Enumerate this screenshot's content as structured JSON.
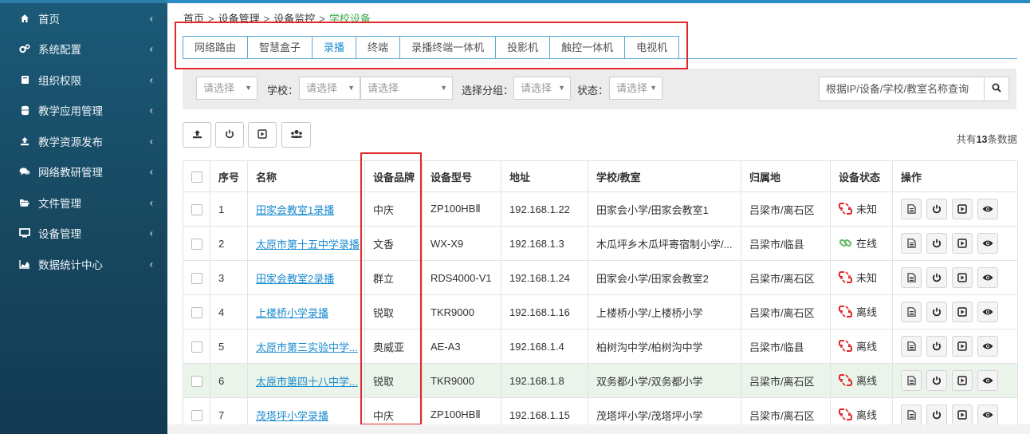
{
  "sidebar": {
    "items": [
      {
        "label": "首页",
        "icon": "home-icon"
      },
      {
        "label": "系统配置",
        "icon": "cogs-icon"
      },
      {
        "label": "组织权限",
        "icon": "book-icon"
      },
      {
        "label": "教学应用管理",
        "icon": "database-icon"
      },
      {
        "label": "教学资源发布",
        "icon": "upload-icon"
      },
      {
        "label": "网络教研管理",
        "icon": "comments-icon"
      },
      {
        "label": "文件管理",
        "icon": "folder-open-icon"
      },
      {
        "label": "设备管理",
        "icon": "monitor-icon"
      },
      {
        "label": "数据统计中心",
        "icon": "area-chart-icon"
      }
    ]
  },
  "breadcrumb": {
    "home": "首页",
    "level1": "设备管理",
    "level2": "设备监控",
    "current": "学校设备",
    "separator": ">"
  },
  "tabs": [
    "网络路由",
    "智慧盒子",
    "录播",
    "终端",
    "录播终端一体机",
    "投影机",
    "触控一体机",
    "电视机"
  ],
  "active_tab": "录播",
  "filters": {
    "select1_placeholder": "请选择",
    "school_label": "学校：",
    "school_placeholder": "请选择",
    "school_class_placeholder": "请选择",
    "group_label": "选择分组：",
    "group_placeholder": "请选择",
    "status_label": "状态：",
    "status_placeholder": "请选择",
    "search_placeholder": "根据IP/设备/学校/教室名称查询"
  },
  "toolbar": {
    "buttons": [
      "upload-icon",
      "power-icon",
      "play-icon",
      "users-icon"
    ],
    "total_prefix": "共有",
    "total_count": "13",
    "total_suffix": "条数据"
  },
  "table": {
    "headers": [
      "序号",
      "名称",
      "设备品牌",
      "设备型号",
      "地址",
      "学校/教室",
      "归属地",
      "设备状态",
      "操作"
    ],
    "rows": [
      {
        "no": "1",
        "name": "田家会教室1录播",
        "brand": "中庆",
        "model": "ZP100HBⅡ",
        "ip": "192.168.1.22",
        "school": "田家会小学/田家会教室1",
        "region": "吕梁市/离石区",
        "status": "未知",
        "status_icon": "unlink-icon"
      },
      {
        "no": "2",
        "name": "太原市第十五中学录播",
        "brand": "文香",
        "model": "WX-X9",
        "ip": "192.168.1.3",
        "school": "木瓜坪乡木瓜坪寄宿制小学/...",
        "region": "吕梁市/临县",
        "status": "在线",
        "status_icon": "link-icon"
      },
      {
        "no": "3",
        "name": "田家会教室2录播",
        "brand": "群立",
        "model": "RDS4000-V1",
        "ip": "192.168.1.24",
        "school": "田家会小学/田家会教室2",
        "region": "吕梁市/离石区",
        "status": "未知",
        "status_icon": "unlink-icon"
      },
      {
        "no": "4",
        "name": "上楼桥小学录播",
        "brand": "锐取",
        "model": "TKR9000",
        "ip": "192.168.1.16",
        "school": "上楼桥小学/上楼桥小学",
        "region": "吕梁市/离石区",
        "status": "离线",
        "status_icon": "unlink-icon"
      },
      {
        "no": "5",
        "name": "太原市第三实验中学...",
        "brand": "奥威亚",
        "model": "AE-A3",
        "ip": "192.168.1.4",
        "school": "柏树沟中学/柏树沟中学",
        "region": "吕梁市/临县",
        "status": "离线",
        "status_icon": "unlink-icon"
      },
      {
        "no": "6",
        "name": "太原市第四十八中学...",
        "brand": "锐取",
        "model": "TKR9000",
        "ip": "192.168.1.8",
        "school": "双务都小学/双务都小学",
        "region": "吕梁市/离石区",
        "status": "离线",
        "status_icon": "unlink-icon"
      },
      {
        "no": "7",
        "name": "茂塔坪小学录播",
        "brand": "中庆",
        "model": "ZP100HBⅡ",
        "ip": "192.168.1.15",
        "school": "茂塔坪小学/茂塔坪小学",
        "region": "吕梁市/离石区",
        "status": "离线",
        "status_icon": "unlink-icon"
      }
    ],
    "highlight_row": "6",
    "row_actions": [
      "file-icon",
      "power-icon",
      "play-icon",
      "eye-icon"
    ]
  },
  "colors": {
    "sidebar_bg": "#17475f",
    "accent": "#1b8bd0",
    "link": "#1b8bd0",
    "breadcrumb_current": "#3aab4a",
    "annotation_red": "#e0282b",
    "status_offline": "#e0282b",
    "status_online": "#5cb85c"
  }
}
